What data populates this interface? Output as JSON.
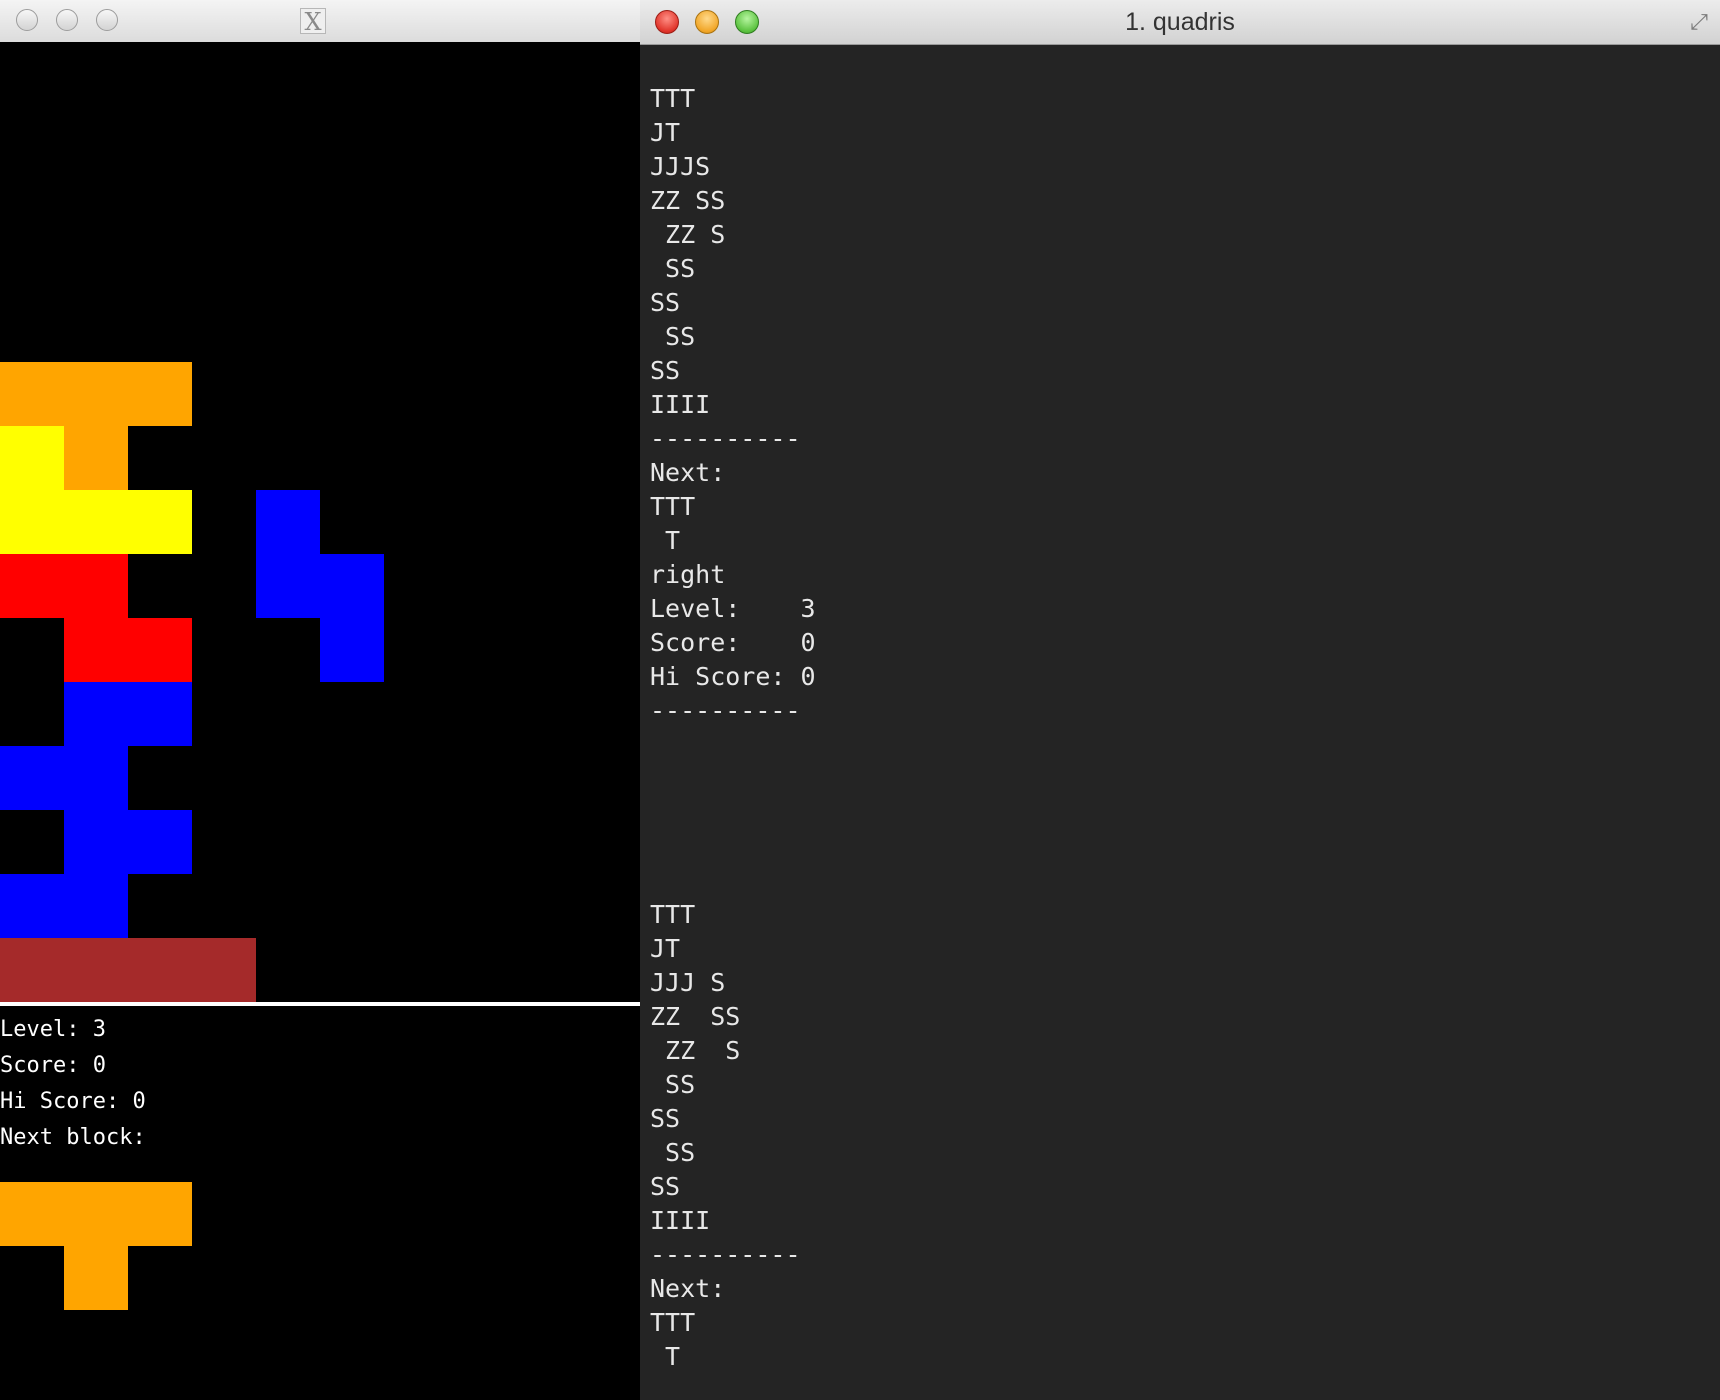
{
  "colors": {
    "T": "#ffa500",
    "J": "#ffff00",
    "Z": "#ff0000",
    "S": "#0000ff",
    "I": "#a52a2a",
    "board_bg": "#000000",
    "terminal_bg": "#242424",
    "terminal_text": "#e8e8e8"
  },
  "icons": {
    "xwindow_logo": "X",
    "fullscreen_icon": "⤢"
  },
  "xwindow": {
    "board_grid": [
      "",
      "",
      "",
      "",
      "",
      "TTT",
      "JT",
      "JJJ S",
      "ZZ  SS",
      " ZZ  S",
      " SS",
      "SS",
      " SS",
      "SS",
      "IIII"
    ],
    "level_text": "Level: 3",
    "score_text": "Score: 0",
    "hiscore_text": "Hi Score: 0",
    "next_label": "Next block:",
    "next_grid": [
      "TTT",
      " T"
    ]
  },
  "terminal": {
    "title": "1. quadris",
    "lines_top": [
      "TTT",
      "JT",
      "JJJS",
      "ZZ SS",
      " ZZ S",
      " SS",
      "SS",
      " SS",
      "SS",
      "IIII",
      "----------",
      "Next:",
      "TTT",
      " T",
      "right",
      "Level:    3",
      "Score:    0",
      "Hi Score: 0",
      "----------"
    ],
    "lines_bottom": [
      "TTT",
      "JT",
      "JJJ S",
      "ZZ  SS",
      " ZZ  S",
      " SS",
      "SS",
      " SS",
      "SS",
      "IIII",
      "----------",
      "Next:",
      "TTT",
      " T"
    ]
  }
}
